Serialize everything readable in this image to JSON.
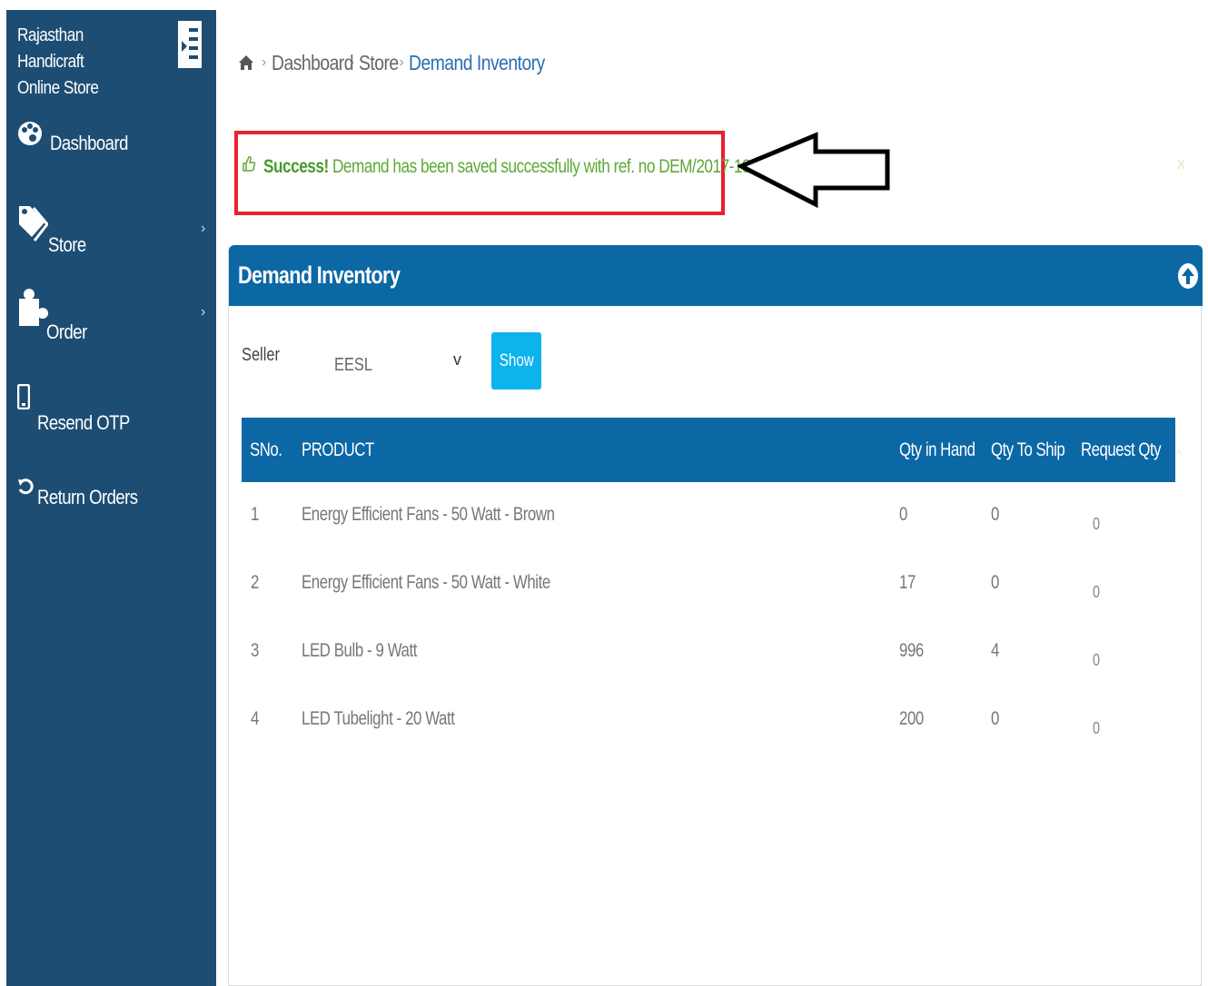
{
  "sidebar": {
    "brand_line1": "Rajasthan Handicraft",
    "brand_line2": "Online Store",
    "items": [
      {
        "label": "Dashboard",
        "icon": "palette-icon"
      },
      {
        "label": "Store",
        "icon": "tags-icon",
        "chevron": "›"
      },
      {
        "label": "Order",
        "icon": "puzzle-icon",
        "chevron": "›"
      },
      {
        "label": "Resend OTP",
        "icon": "mobile-icon"
      },
      {
        "label": "Return Orders",
        "icon": "undo-icon"
      }
    ],
    "bg_color": "#1d4d73"
  },
  "breadcrumb": {
    "items": [
      "Dashboard",
      "Store"
    ],
    "active": "Demand Inventory",
    "separator": "›"
  },
  "alert": {
    "strong": "Success!",
    "message": " Demand has been saved successfully with ref. no DEM/2017-18/10026",
    "close": "x",
    "color": "#5ea837",
    "highlight_border": "#e8202f"
  },
  "panel": {
    "title": "Demand Inventory",
    "header_color": "#0c67a5"
  },
  "filter": {
    "seller_label": "Seller",
    "seller_value": "EESL",
    "caret": "v",
    "show_label": "Show",
    "button_color": "#0cb3ed"
  },
  "table": {
    "columns": [
      "SNo.",
      "PRODUCT",
      "Qty in Hand",
      "Qty To Ship",
      "Request Qty"
    ],
    "sort_caret": "^",
    "rows": [
      {
        "sno": "1",
        "product": "Energy Efficient Fans - 50 Watt - Brown",
        "qty_in_hand": "0",
        "qty_to_ship": "0",
        "request_qty": "0"
      },
      {
        "sno": "2",
        "product": "Energy Efficient Fans - 50 Watt - White",
        "qty_in_hand": "17",
        "qty_to_ship": "0",
        "request_qty": "0"
      },
      {
        "sno": "3",
        "product": "LED Bulb - 9 Watt",
        "qty_in_hand": "996",
        "qty_to_ship": "4",
        "request_qty": "0"
      },
      {
        "sno": "4",
        "product": "LED Tubelight - 20 Watt",
        "qty_in_hand": "200",
        "qty_to_ship": "0",
        "request_qty": "0"
      }
    ]
  }
}
